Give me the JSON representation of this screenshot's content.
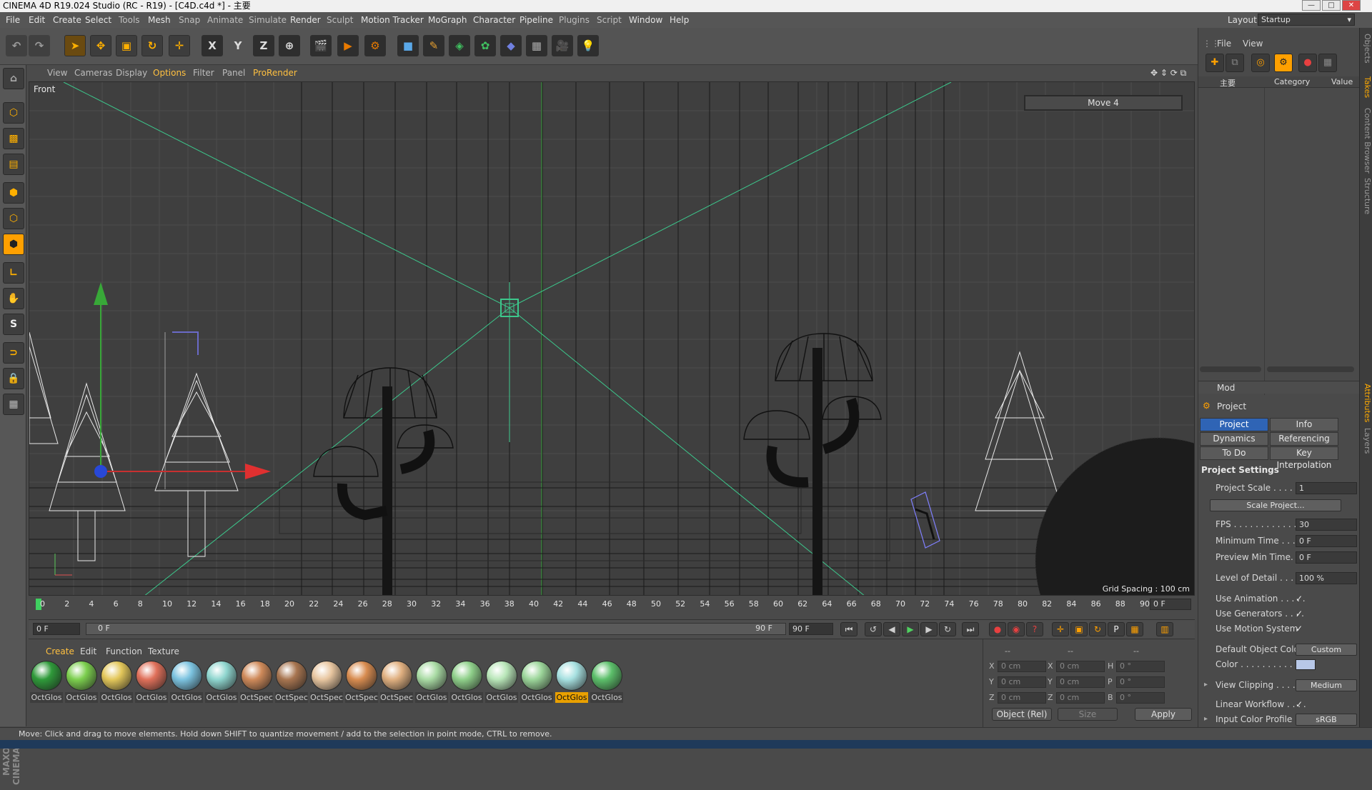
{
  "window": {
    "title": "CINEMA 4D R19.024 Studio (RC - R19) - [C4D.c4d *] - 主要",
    "minimize": "—",
    "maximize": "□",
    "close": "✕"
  },
  "menubar": {
    "items": [
      "File",
      "Edit",
      "Create",
      "Select",
      "Tools",
      "Mesh",
      "Snap",
      "Animate",
      "Simulate",
      "Render",
      "Sculpt",
      "Motion Tracker",
      "MoGraph",
      "Character",
      "Pipeline",
      "Plugins",
      "Script",
      "Window",
      "Help"
    ],
    "layout_label": "Layout:",
    "layout_value": "Startup"
  },
  "toolbar": {
    "undo_icon": "undo-icon",
    "axis_x": "X",
    "axis_y": "Y",
    "axis_z": "Z"
  },
  "viewport_menu": {
    "items": [
      "View",
      "Cameras",
      "Display",
      "Options",
      "Filter",
      "Panel",
      "ProRender"
    ]
  },
  "viewport": {
    "label": "Front",
    "hud": "Move 4",
    "grid_spacing": "Grid Spacing : 100 cm"
  },
  "timeline": {
    "ticks": [
      "0",
      "2",
      "4",
      "6",
      "8",
      "10",
      "12",
      "14",
      "16",
      "18",
      "20",
      "22",
      "24",
      "26",
      "28",
      "30",
      "32",
      "34",
      "36",
      "38",
      "40",
      "42",
      "44",
      "46",
      "48",
      "50",
      "52",
      "54",
      "56",
      "58",
      "60",
      "62",
      "64",
      "66",
      "68",
      "70",
      "72",
      "74",
      "76",
      "78",
      "80",
      "82",
      "84",
      "86",
      "88",
      "90"
    ],
    "current_frame": "0 F",
    "start_frame": "0 F",
    "range_start": "0 F",
    "range_end": "90 F",
    "end_frame": "90 F"
  },
  "material_manager": {
    "menu": [
      "Create",
      "Edit",
      "Function",
      "Texture"
    ],
    "materials": [
      {
        "name": "OctGlos",
        "color": "#2f9a3a"
      },
      {
        "name": "OctGlos",
        "color": "#7ccf4e"
      },
      {
        "name": "OctGlos",
        "color": "#e3c75a"
      },
      {
        "name": "OctGlos",
        "color": "#e0705a"
      },
      {
        "name": "OctGlos",
        "color": "#7cc3e0"
      },
      {
        "name": "OctGlos",
        "color": "#8fd6cf"
      },
      {
        "name": "OctSpec",
        "color": "#cf8a5a"
      },
      {
        "name": "OctSpec",
        "color": "#a87550"
      },
      {
        "name": "OctSpec",
        "color": "#e8c6a0"
      },
      {
        "name": "OctSpec",
        "color": "#d88c50"
      },
      {
        "name": "OctSpec",
        "color": "#e0b080"
      },
      {
        "name": "OctGlos",
        "color": "#a9dba4"
      },
      {
        "name": "OctGlos",
        "color": "#8fd08a"
      },
      {
        "name": "OctGlos",
        "color": "#b8e6b8"
      },
      {
        "name": "OctGlos",
        "color": "#9cd69a"
      },
      {
        "name": "OctGlos",
        "color": "#a6e0e0",
        "selected": true
      },
      {
        "name": "OctGlos",
        "color": "#5cbf6a"
      }
    ]
  },
  "coords": {
    "head": [
      "--",
      "--",
      "--"
    ],
    "rows": [
      {
        "l1": "X",
        "v1": "0 cm",
        "l2": "X",
        "v2": "0 cm",
        "l3": "H",
        "v3": "0 °"
      },
      {
        "l1": "Y",
        "v1": "0 cm",
        "l2": "Y",
        "v2": "0 cm",
        "l3": "P",
        "v3": "0 °"
      },
      {
        "l1": "Z",
        "v1": "0 cm",
        "l2": "Z",
        "v2": "0 cm",
        "l3": "B",
        "v3": "0 °"
      }
    ],
    "mode": "Object (Rel)",
    "size_mode": "Size",
    "apply": "Apply"
  },
  "objects_panel": {
    "menu": [
      "File",
      "View"
    ],
    "takes_root": "主要",
    "col_category": "Category",
    "col_value": "Value"
  },
  "attributes": {
    "mode": "Mod",
    "title": "Project",
    "tabs": [
      "Project Settings",
      "Info",
      "Dynamics",
      "Referencing",
      "To Do",
      "Key Interpolation"
    ],
    "section": "Project Settings",
    "rows": {
      "project_scale": {
        "label": "Project Scale . . . . . .",
        "value": "1"
      },
      "scale_project": "Scale Project...",
      "fps": {
        "label": "FPS . . . . . . . . . . . . . .",
        "value": "30"
      },
      "min_time": {
        "label": "Minimum Time . . . . .",
        "value": "0 F"
      },
      "preview_min": {
        "label": "Preview Min Time. . . .",
        "value": "0 F"
      },
      "lod": {
        "label": "Level of Detail . . . . . .",
        "value": "100 %"
      },
      "use_animation": "Use Animation . . . . .",
      "use_generators": "Use Generators . . . .",
      "use_motion": "Use Motion System",
      "default_color": {
        "label": "Default Object Color",
        "value": "Custom"
      },
      "color": "Color . . . . . . . . . . .",
      "view_clipping": {
        "label": "View Clipping . . . . . .",
        "value": "Medium"
      },
      "linear_workflow": "Linear Workflow . . . .",
      "input_profile": {
        "label": "Input Color Profile . .",
        "value": "sRGB"
      }
    },
    "check": "✓"
  },
  "side_tabs": [
    "Objects",
    "Takes",
    "Content Browser",
    "Structure",
    "Attributes",
    "Layers"
  ],
  "status": "Move: Click and drag to move elements. Hold down SHIFT to quantize movement / add to the selection in point mode, CTRL to remove.",
  "left_brand": "MAXON CINEMA 4D",
  "colors": {
    "accent": "#ffa000",
    "selection": "#2f64b5",
    "grid_green": "#3cc88c"
  }
}
